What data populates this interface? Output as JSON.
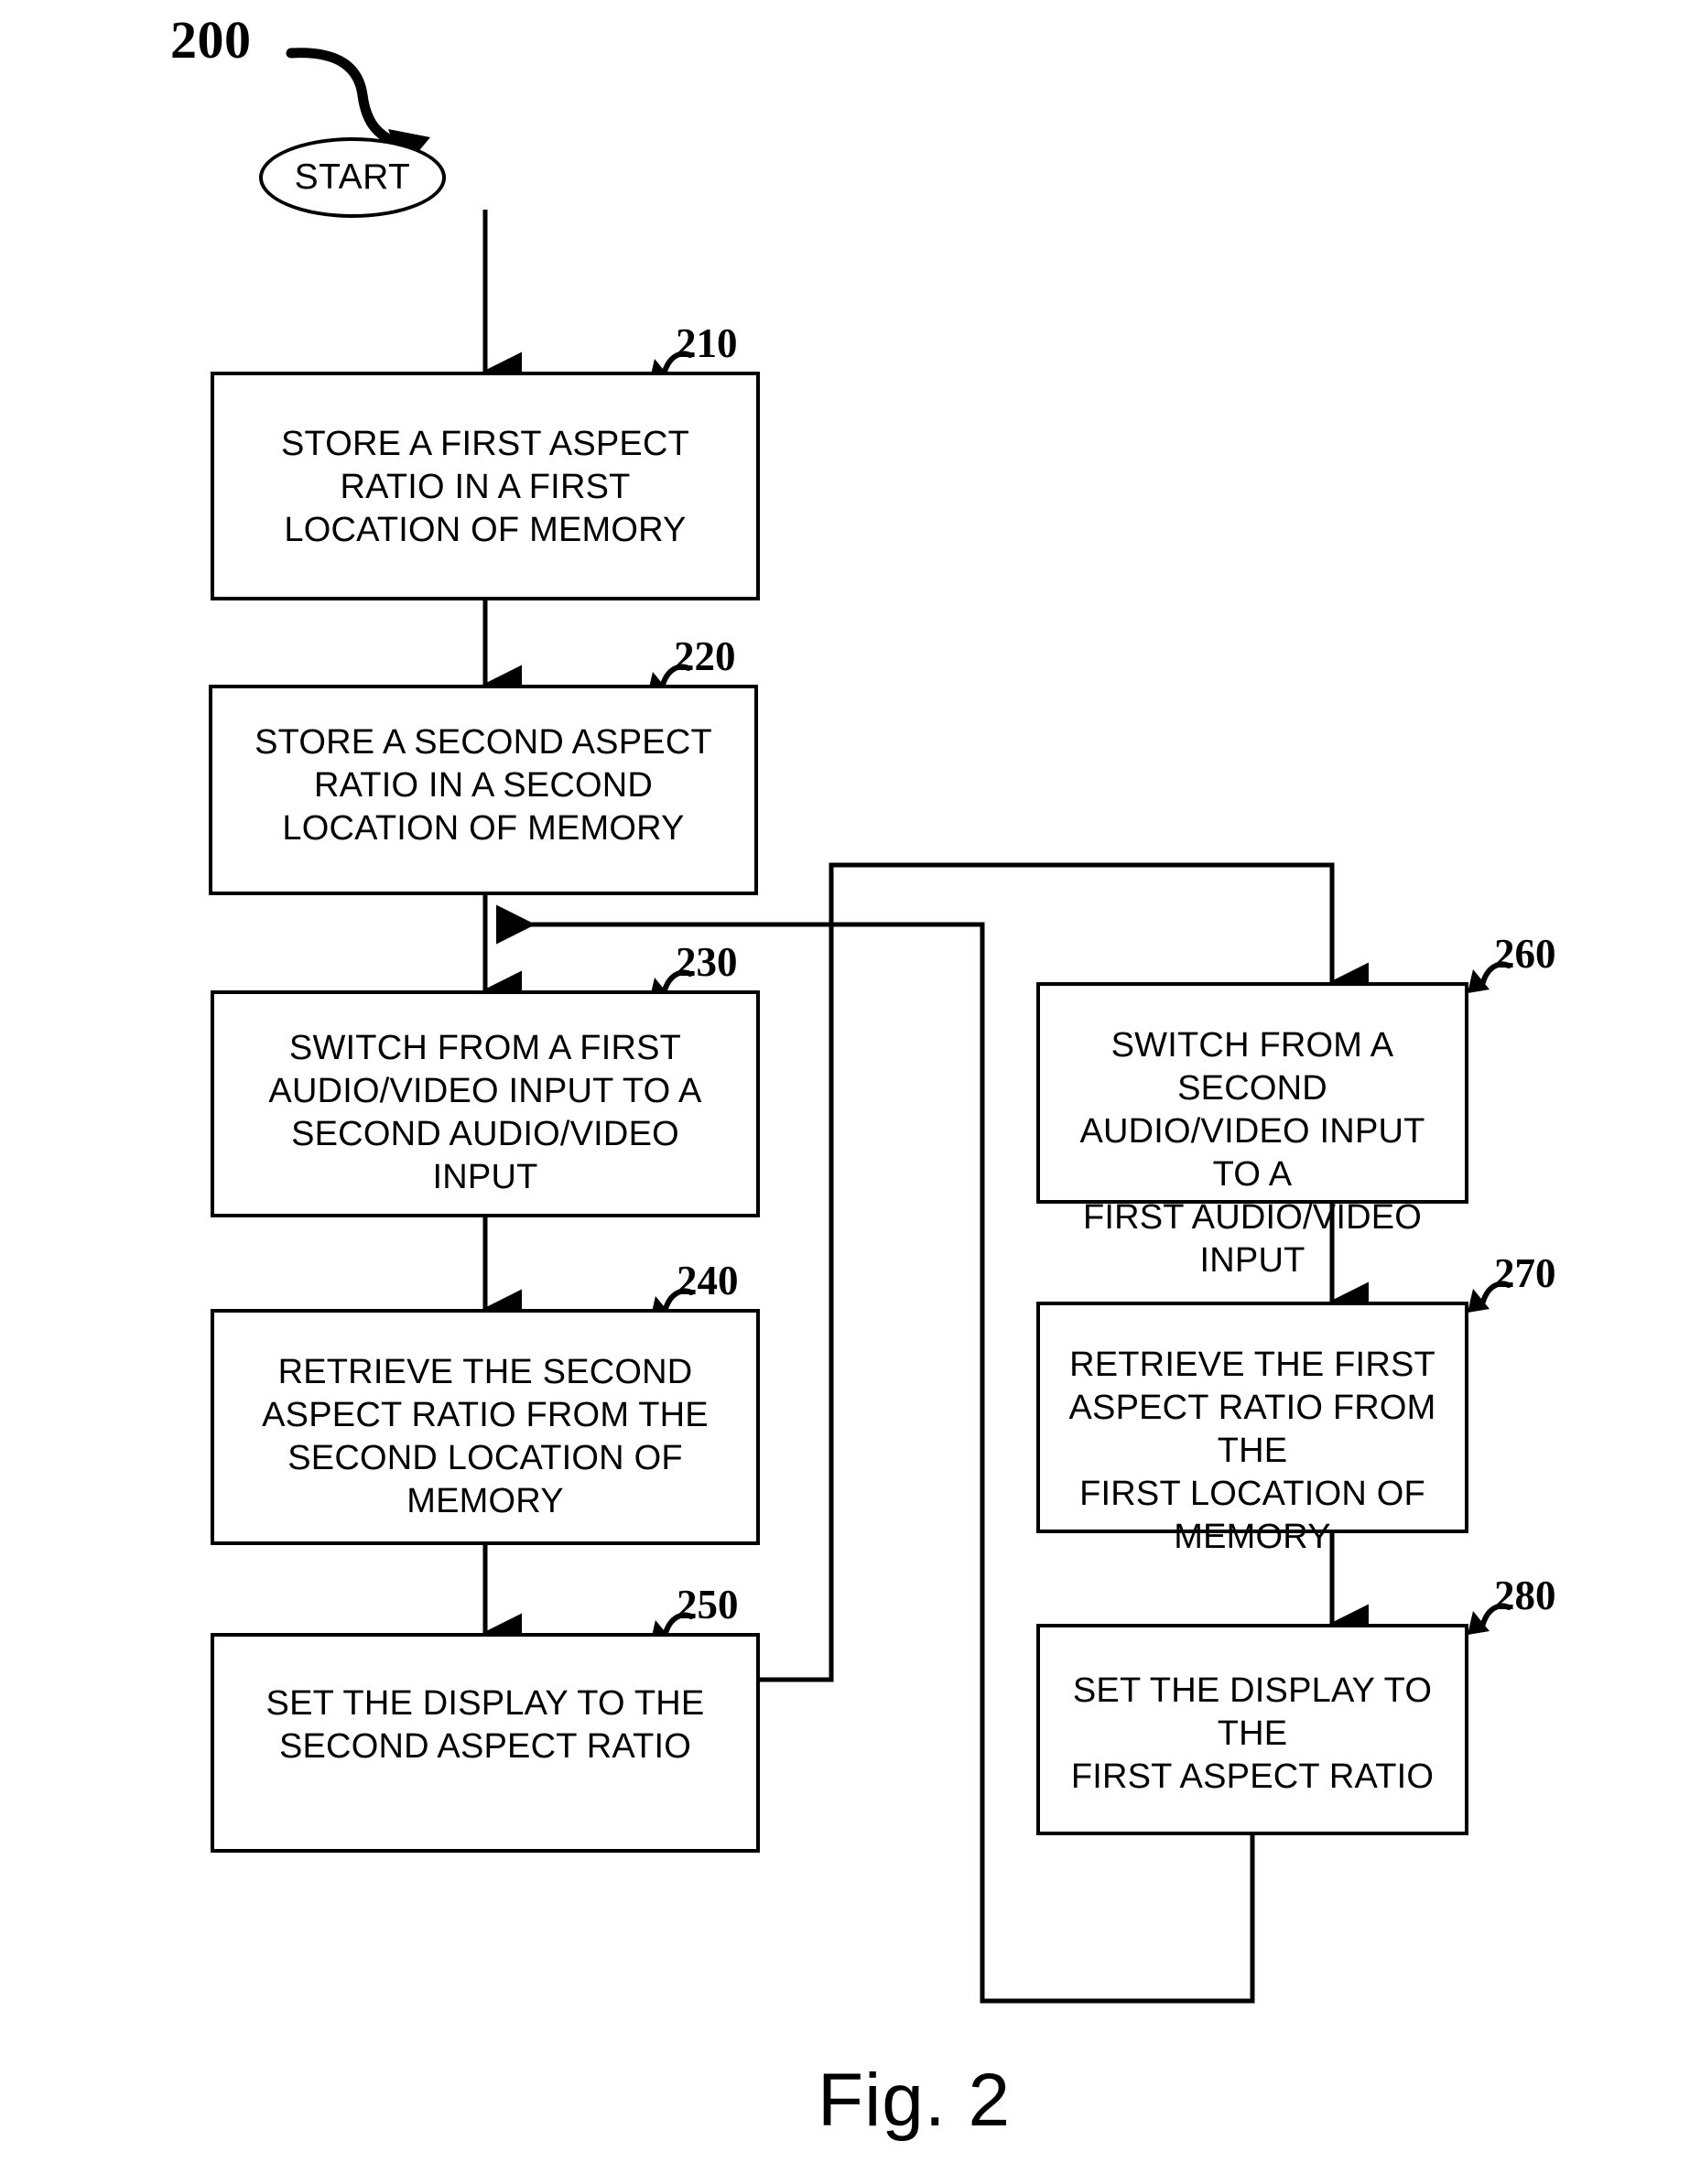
{
  "figure": {
    "main_reference": "200",
    "caption": "Fig. 2"
  },
  "terminator": {
    "label": "START"
  },
  "nodes": [
    {
      "id": "210",
      "callout": "210",
      "text": "STORE A FIRST ASPECT RATIO IN A FIRST LOCATION OF MEMORY",
      "lines": [
        "STORE A FIRST ASPECT",
        "RATIO IN A FIRST",
        "LOCATION OF MEMORY"
      ]
    },
    {
      "id": "220",
      "callout": "220",
      "text": "STORE A SECOND ASPECT RATIO IN A SECOND LOCATION OF MEMORY",
      "lines": [
        "STORE A SECOND ASPECT",
        "RATIO IN A SECOND",
        "LOCATION OF MEMORY"
      ]
    },
    {
      "id": "230",
      "callout": "230",
      "text": "SWITCH FROM A FIRST AUDIO/VIDEO INPUT TO A SECOND AUDIO/VIDEO INPUT",
      "lines": [
        "SWITCH FROM A FIRST",
        "AUDIO/VIDEO INPUT TO A",
        "SECOND AUDIO/VIDEO",
        "INPUT"
      ]
    },
    {
      "id": "240",
      "callout": "240",
      "text": "RETRIEVE THE SECOND ASPECT RATIO FROM THE SECOND LOCATION OF MEMORY",
      "lines": [
        "RETRIEVE THE SECOND",
        "ASPECT RATIO FROM THE",
        "SECOND LOCATION OF",
        "MEMORY"
      ]
    },
    {
      "id": "250",
      "callout": "250",
      "text": "SET THE DISPLAY TO THE SECOND ASPECT RATIO",
      "lines": [
        "SET THE DISPLAY TO THE",
        "SECOND ASPECT RATIO"
      ]
    },
    {
      "id": "260",
      "callout": "260",
      "text": "SWITCH FROM A SECOND AUDIO/VIDEO INPUT TO A FIRST AUDIO/VIDEO INPUT",
      "lines": [
        "SWITCH FROM A SECOND",
        "AUDIO/VIDEO INPUT TO A",
        "FIRST AUDIO/VIDEO INPUT"
      ]
    },
    {
      "id": "270",
      "callout": "270",
      "text": "RETRIEVE THE FIRST ASPECT RATIO FROM THE FIRST LOCATION OF MEMORY",
      "lines": [
        "RETRIEVE THE FIRST",
        "ASPECT RATIO FROM THE",
        "FIRST LOCATION OF",
        "MEMORY"
      ]
    },
    {
      "id": "280",
      "callout": "280",
      "text": "SET THE DISPLAY TO THE FIRST ASPECT RATIO",
      "lines": [
        "SET THE DISPLAY TO THE",
        "FIRST ASPECT RATIO"
      ]
    }
  ],
  "colors": {
    "ink": "#000000",
    "paper": "#ffffff"
  }
}
